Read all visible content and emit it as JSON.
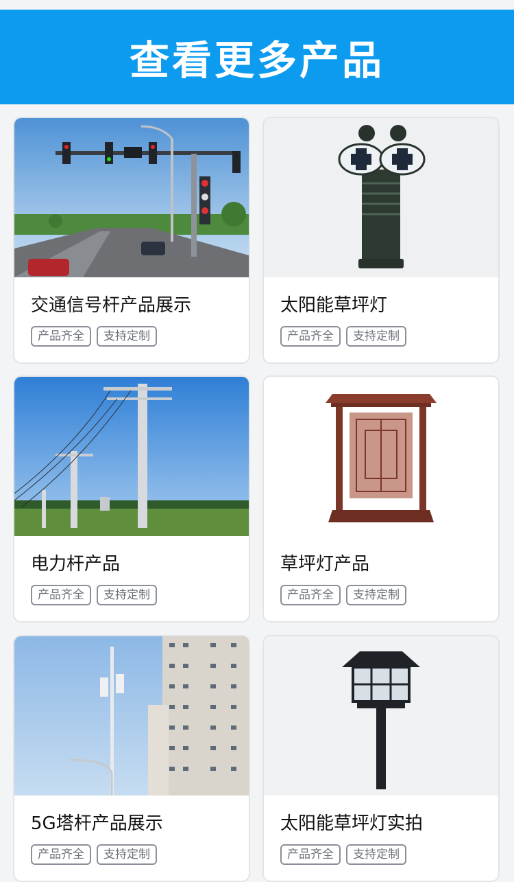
{
  "banner": {
    "title": "查看更多产品"
  },
  "products": [
    {
      "title": "交通信号杆产品展示",
      "tags": [
        "产品齐全",
        "支持定制"
      ],
      "image": "traffic-signal-pole-photo"
    },
    {
      "title": "太阳能草坪灯",
      "tags": [
        "产品齐全",
        "支持定制"
      ],
      "image": "solar-lawn-lamp-photo"
    },
    {
      "title": "电力杆产品",
      "tags": [
        "产品齐全",
        "支持定制"
      ],
      "image": "power-pole-photo"
    },
    {
      "title": "草坪灯产品",
      "tags": [
        "产品齐全",
        "支持定制"
      ],
      "image": "lawn-lamp-photo"
    },
    {
      "title": "5G塔杆产品展示",
      "tags": [
        "产品齐全",
        "支持定制"
      ],
      "image": "5g-tower-pole-photo"
    },
    {
      "title": "太阳能草坪灯实拍",
      "tags": [
        "产品齐全",
        "支持定制"
      ],
      "image": "solar-lawn-lamp-real-photo"
    }
  ],
  "colors": {
    "banner": "#0d9bf0",
    "card_border": "#e2e4e8",
    "tag_border": "#8a8f99"
  }
}
